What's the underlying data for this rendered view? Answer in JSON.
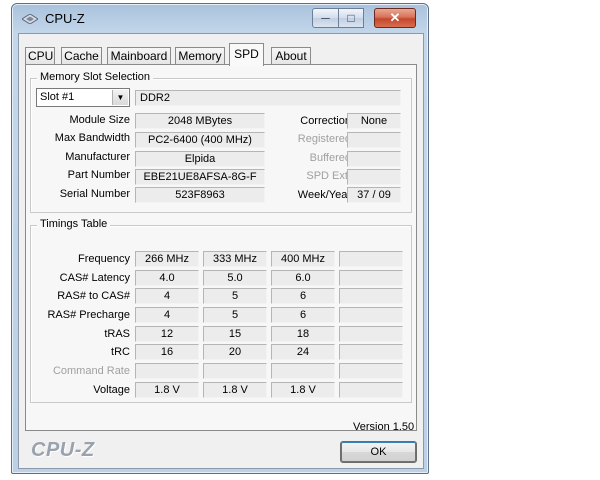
{
  "window": {
    "title": "CPU-Z"
  },
  "tabs": [
    "CPU",
    "Cache",
    "Mainboard",
    "Memory",
    "SPD",
    "About"
  ],
  "active_tab": "SPD",
  "slot_group": {
    "title": "Memory Slot Selection",
    "slot_value": "Slot #1",
    "type_value": "DDR2",
    "rows": [
      {
        "label": "Module Size",
        "value": "2048 MBytes",
        "right_label": "Correction",
        "right_value": "None"
      },
      {
        "label": "Max Bandwidth",
        "value": "PC2-6400 (400 MHz)",
        "right_label": "Registered",
        "right_value": ""
      },
      {
        "label": "Manufacturer",
        "value": "Elpida",
        "right_label": "Buffered",
        "right_value": ""
      },
      {
        "label": "Part Number",
        "value": "EBE21UE8AFSA-8G-F",
        "right_label": "SPD Ext.",
        "right_value": ""
      },
      {
        "label": "Serial Number",
        "value": "523F8963",
        "right_label": "Week/Year",
        "right_value": "37 / 09"
      }
    ]
  },
  "timings": {
    "title": "Timings Table",
    "headers": [
      "266 MHz",
      "333 MHz",
      "400 MHz",
      ""
    ],
    "rows": [
      {
        "label": "Frequency",
        "values": [
          "266 MHz",
          "333 MHz",
          "400 MHz",
          ""
        ]
      },
      {
        "label": "CAS# Latency",
        "values": [
          "4.0",
          "5.0",
          "6.0",
          ""
        ]
      },
      {
        "label": "RAS# to CAS#",
        "values": [
          "4",
          "5",
          "6",
          ""
        ]
      },
      {
        "label": "RAS# Precharge",
        "values": [
          "4",
          "5",
          "6",
          ""
        ]
      },
      {
        "label": "tRAS",
        "values": [
          "12",
          "15",
          "18",
          ""
        ]
      },
      {
        "label": "tRC",
        "values": [
          "16",
          "20",
          "24",
          ""
        ]
      },
      {
        "label": "Command Rate",
        "values": [
          "",
          "",
          "",
          ""
        ]
      },
      {
        "label": "Voltage",
        "values": [
          "1.8 V",
          "1.8 V",
          "1.8 V",
          ""
        ]
      }
    ]
  },
  "footer": {
    "version": "Version 1.50",
    "logo": "CPU-Z",
    "ok_label": "OK"
  },
  "colors": {
    "title_gradient_top": "#a9c2dc",
    "close_button": "#c4472b",
    "panel_bg": "#f7f7f7"
  },
  "icons": {
    "app": "cpu-z-logo-icon",
    "minimize": "minimize-icon",
    "maximize": "maximize-icon",
    "close": "close-icon",
    "dropdown": "chevron-down-icon"
  }
}
